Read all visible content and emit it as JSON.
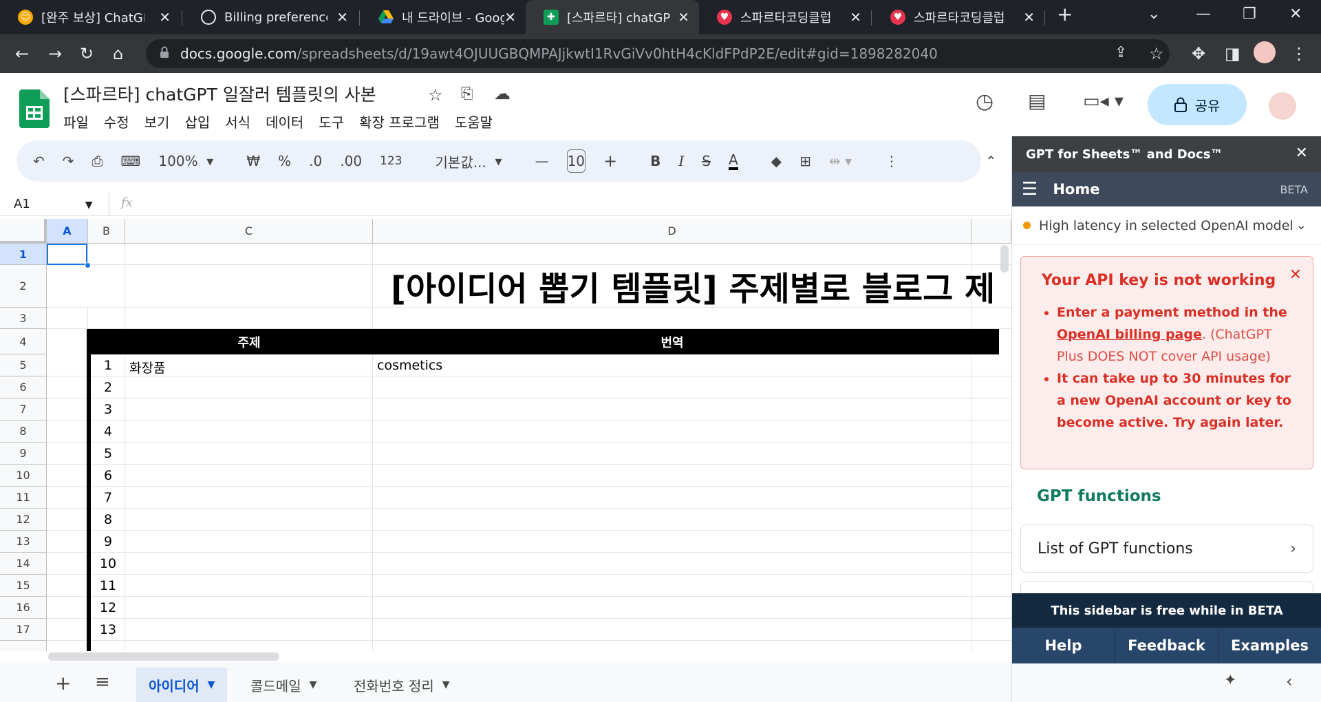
{
  "browser": {
    "tabs": [
      {
        "title": "[완주 보상] ChatGPT",
        "icon": "emoji-smile-icon"
      },
      {
        "title": "Billing preferences",
        "icon": "openai-icon"
      },
      {
        "title": "내 드라이브 - Google",
        "icon": "google-drive-icon"
      },
      {
        "title": "[스파르타] chatGPT",
        "icon": "google-sheets-icon",
        "active": true
      },
      {
        "title": "스파르타코딩클럽",
        "icon": "sparta-icon"
      },
      {
        "title": "스파르타코딩클럽",
        "icon": "sparta-icon"
      }
    ],
    "url_host": "docs.google.com",
    "url_path": "/spreadsheets/d/19awt4OJUUGBQMPAJjkwtI1RvGiVv0htH4cKldFPdP2E/edit#gid=1898282040"
  },
  "sheets": {
    "doc_title": "[스파르타] chatGPT 일잘러 템플릿의 사본",
    "menu": [
      "파일",
      "수정",
      "보기",
      "삽입",
      "서식",
      "데이터",
      "도구",
      "확장 프로그램",
      "도움말"
    ],
    "share_label": "공유",
    "toolbar": {
      "zoom": "100%",
      "currency": "₩",
      "percent": "%",
      "dec_decrease": ".0",
      "dec_increase": ".00",
      "number_format": "123",
      "font": "기본값...",
      "font_size": "10"
    },
    "name_box": "A1",
    "formula_icon": "fx",
    "columns": [
      "A",
      "B",
      "C",
      "D"
    ],
    "rows": [
      "1",
      "2",
      "3",
      "4",
      "5",
      "6",
      "7",
      "8",
      "9",
      "10",
      "11",
      "12",
      "13",
      "14",
      "15",
      "16",
      "17"
    ],
    "big_title": "[아이디어 뽑기 템플릿] 주제별로 블로그 제",
    "header_topic": "주제",
    "header_translation": "번역",
    "numbers": [
      "1",
      "2",
      "3",
      "4",
      "5",
      "6",
      "7",
      "8",
      "9",
      "10",
      "11",
      "12",
      "13"
    ],
    "cell_topic": "화장품",
    "cell_translation": "cosmetics",
    "sheet_tabs": [
      "아이디어",
      "콜드메일",
      "전화번호 정리"
    ]
  },
  "sidebar": {
    "title": "GPT for Sheets™ and Docs™",
    "nav_title": "Home",
    "beta": "BETA",
    "status": "High latency in selected OpenAI model",
    "alert_title": "Your API key is not working",
    "alert_item1_bold": "Enter a payment method in the",
    "alert_item1_link": "OpenAI billing page",
    "alert_item1_rest": ". (ChatGPT Plus DOES NOT cover API usage)",
    "alert_item2": "It can take up to 30 minutes for a new OpenAI account or key to become active. Try again later.",
    "functions_title": "GPT functions",
    "functions_card": "List of GPT functions",
    "banner": "This sidebar is free while in BETA",
    "footer": [
      "Help",
      "Feedback",
      "Examples"
    ]
  },
  "colors": {
    "accent": "#1a73e8",
    "alert_text": "#d93025",
    "sidebar_green": "#0f7b5f",
    "sidebar_footer": "#27466a"
  }
}
